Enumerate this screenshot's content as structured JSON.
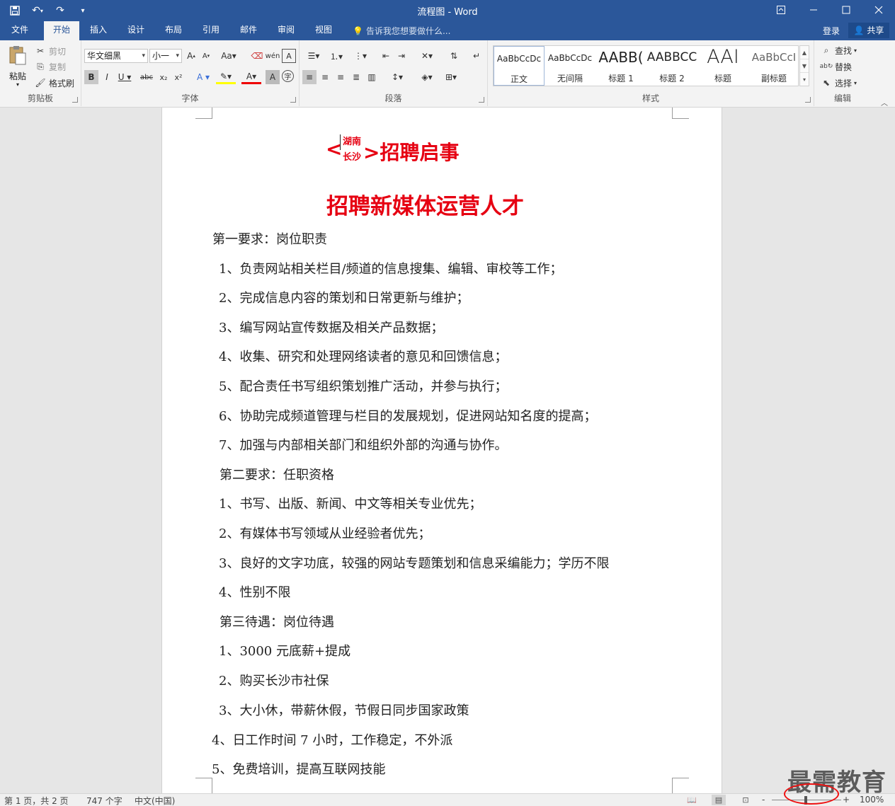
{
  "window": {
    "title": "流程图 - Word",
    "qat": {
      "save_icon": "save-icon",
      "undo_icon": "undo-icon",
      "redo_icon": "redo-icon",
      "customize_icon": "customize-icon"
    }
  },
  "tabs": [
    {
      "label": "文件"
    },
    {
      "label": "开始"
    },
    {
      "label": "插入"
    },
    {
      "label": "设计"
    },
    {
      "label": "布局"
    },
    {
      "label": "引用"
    },
    {
      "label": "邮件"
    },
    {
      "label": "审阅"
    },
    {
      "label": "视图"
    }
  ],
  "active_tab": "开始",
  "tell_me": "告诉我您想要做什么...",
  "account": {
    "login": "登录",
    "share": "共享"
  },
  "ribbon": {
    "clipboard": {
      "label": "剪贴板",
      "paste": "粘贴",
      "cut": "剪切",
      "copy": "复制",
      "format_painter": "格式刷"
    },
    "font": {
      "label": "字体",
      "font_name": "华文细黑",
      "font_size": "小一"
    },
    "paragraph": {
      "label": "段落"
    },
    "styles": {
      "label": "样式",
      "items": [
        {
          "sample": "AaBbCcDc",
          "name": "正文"
        },
        {
          "sample": "AaBbCcDc",
          "name": "无间隔"
        },
        {
          "sample": "AABB(",
          "name": "标题 1"
        },
        {
          "sample": "AABBCC",
          "name": "标题 2"
        },
        {
          "sample": "AAI",
          "name": "标题"
        },
        {
          "sample": "AaBbCcI",
          "name": "副标题"
        }
      ]
    },
    "editing": {
      "label": "编辑",
      "find": "查找",
      "replace": "替换",
      "select": "选择"
    }
  },
  "document": {
    "combined_chars": [
      "湖南",
      "长沙"
    ],
    "title_left": "<",
    "title_right": ">招聘启事",
    "subtitle": "招聘新媒体运营人才",
    "lines": [
      "第一要求：岗位职责",
      "1、负责网站相关栏目/频道的信息搜集、编辑、审校等工作；",
      "2、完成信息内容的策划和日常更新与维护；",
      "3、编写网站宣传数据及相关产品数据；",
      "4、收集、研究和处理网络读者的意见和回馈信息；",
      "5、配合责任书写组织策划推广活动，并参与执行；",
      "6、协助完成频道管理与栏目的发展规划，促进网站知名度的提高；",
      "7、加强与内部相关部门和组织外部的沟通与协作。",
      "第二要求：任职资格",
      "1、书写、出版、新闻、中文等相关专业优先；",
      "2、有媒体书写领域从业经验者优先；",
      "3、良好的文字功底，较强的网站专题策划和信息采编能力；学历不限",
      "4、性别不限",
      "第三待遇：岗位待遇",
      "1、3000 元底薪+提成",
      "2、购买长沙市社保",
      "3、大小休，带薪休假，节假日同步国家政策",
      "4、日工作时间 7 小时，工作稳定，不外派",
      "5、免费培训，提高互联网技能"
    ]
  },
  "status": {
    "page": "第 1 页，共 2 页",
    "words": "747 个字",
    "language": "中文(中国)",
    "zoom": "100%",
    "zoom_minus": "-",
    "zoom_plus": "+"
  },
  "watermark": "最需教育",
  "colors": {
    "brand": "#2b579a",
    "heading_red": "#e60012"
  }
}
